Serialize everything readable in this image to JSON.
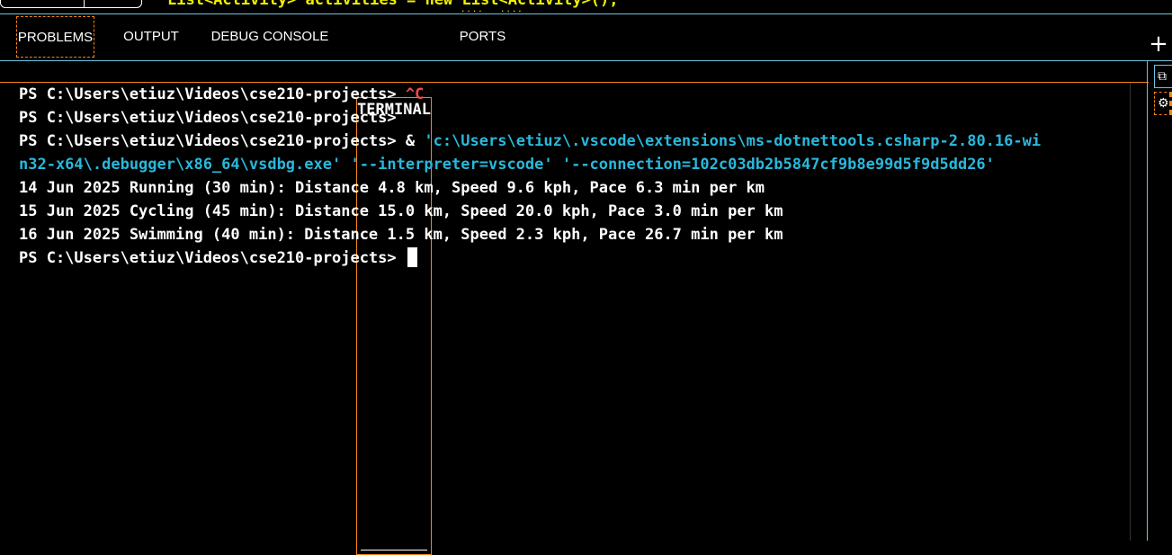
{
  "code_fragment": "List<Activity> activities = new List<Activity>();",
  "tabs": {
    "problems": "PROBLEMS",
    "output": "OUTPUT",
    "debug_console": "DEBUG CONSOLE",
    "terminal": "TERMINAL",
    "ports": "PORTS",
    "active": "TERMINAL"
  },
  "toolbar": {
    "new_terminal_icon": "plus-icon",
    "new_terminal_glyph": "+"
  },
  "side_panel": {
    "terminal_instance_icon": "terminal-icon",
    "debug_instance_icon": "debug-icon"
  },
  "terminal": {
    "prompt": "PS C:\\Users\\etiuz\\Videos\\cse210-projects>",
    "interrupt": "^C",
    "debug_command_prefix": " & ",
    "debug_command_line1": "'c:\\Users\\etiuz\\.vscode\\extensions\\ms-dotnettools.csharp-2.80.16-wi",
    "debug_command_line2": "n32-x64\\.debugger\\x86_64\\vsdbg.exe' '--interpreter=vscode' '--connection=102c03db2b5847cf9b8e99d5f9d5dd26'",
    "output_lines": [
      "14 Jun 2025 Running (30 min): Distance 4.8 km, Speed 9.6 kph, Pace 6.3 min per km",
      "15 Jun 2025 Cycling (45 min): Distance 15.0 km, Speed 20.0 kph, Pace 3.0 min per km",
      "16 Jun 2025 Swimming (40 min): Distance 1.5 km, Speed 2.3 kph, Pace 26.7 min per km"
    ]
  },
  "colors": {
    "background": "#000000",
    "focus_border": "#f38518",
    "panel_border": "#6fc3df",
    "error_red": "#f14c4c",
    "string_cyan": "#29b8db"
  }
}
